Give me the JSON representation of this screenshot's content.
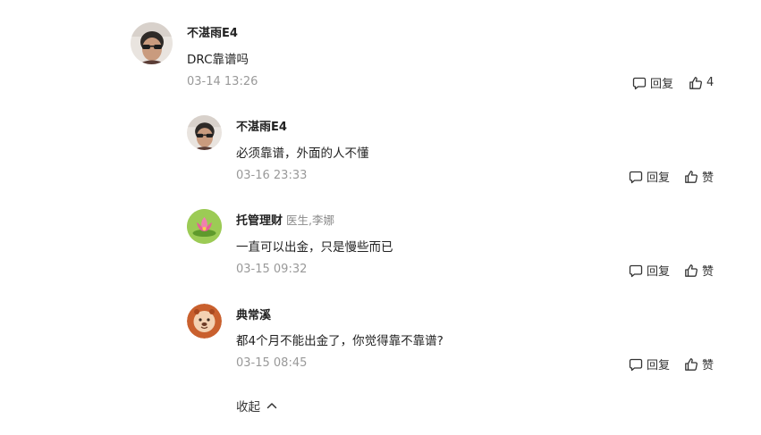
{
  "comments": [
    {
      "user": "不湛雨E4",
      "tag": "",
      "text": "DRC靠谱吗",
      "time": "03-14 13:26",
      "reply_label": "回复",
      "like_label": "4"
    },
    {
      "user": "不湛雨E4",
      "tag": "",
      "text": "必须靠谱，外面的人不懂",
      "time": "03-16 23:33",
      "reply_label": "回复",
      "like_label": "赞"
    },
    {
      "user": "托管理财",
      "tag": "医生,李娜",
      "text": "一直可以出金，只是慢些而已",
      "time": "03-15 09:32",
      "reply_label": "回复",
      "like_label": "赞"
    },
    {
      "user": "典常溪",
      "tag": "",
      "text": "都4个月不能出金了，你觉得靠不靠谱?",
      "time": "03-15 08:45",
      "reply_label": "回复",
      "like_label": "赞"
    }
  ],
  "collapse_label": "收起",
  "icons": {
    "reply": "comment-bubble-icon",
    "like": "thumbs-up-icon",
    "collapse": "chevron-up-icon"
  },
  "colors": {
    "text": "#222222",
    "meta": "#999999",
    "tag": "#8a8a8a"
  }
}
